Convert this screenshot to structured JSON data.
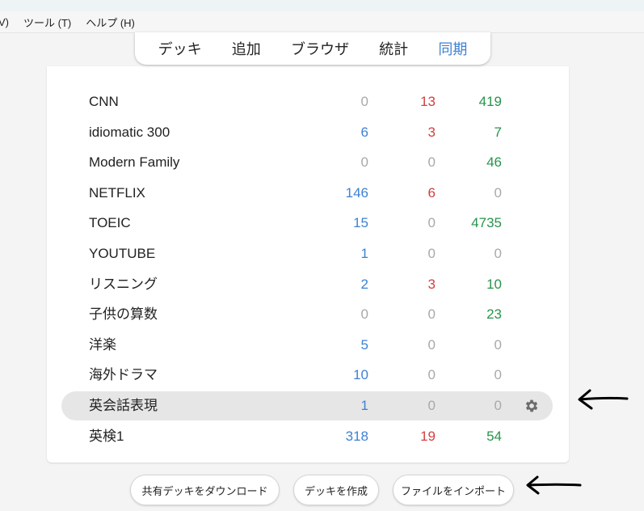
{
  "menu": {
    "items": [
      "V)",
      "ツール (T)",
      "ヘルプ (H)"
    ]
  },
  "toolbar": {
    "tabs": [
      {
        "label": "デッキ",
        "active": false
      },
      {
        "label": "追加",
        "active": false
      },
      {
        "label": "ブラウザ",
        "active": false
      },
      {
        "label": "統計",
        "active": false
      },
      {
        "label": "同期",
        "active": true
      }
    ]
  },
  "colors": {
    "new": "#3d82d4",
    "learn": "#d23f3f",
    "due": "#27944c",
    "zero": "#a9a9a9",
    "active_tab": "#3d82d4"
  },
  "decks": [
    {
      "name": "CNN",
      "new": "0",
      "learn": "13",
      "due": "419"
    },
    {
      "name": "idiomatic 300",
      "new": "6",
      "learn": "3",
      "due": "7"
    },
    {
      "name": "Modern Family",
      "new": "0",
      "learn": "0",
      "due": "46"
    },
    {
      "name": "NETFLIX",
      "new": "146",
      "learn": "6",
      "due": "0"
    },
    {
      "name": "TOEIC",
      "new": "15",
      "learn": "0",
      "due": "4735"
    },
    {
      "name": "YOUTUBE",
      "new": "1",
      "learn": "0",
      "due": "0"
    },
    {
      "name": "リスニング",
      "new": "2",
      "learn": "3",
      "due": "10"
    },
    {
      "name": "子供の算数",
      "new": "0",
      "learn": "0",
      "due": "23"
    },
    {
      "name": "洋楽",
      "new": "5",
      "learn": "0",
      "due": "0"
    },
    {
      "name": "海外ドラマ",
      "new": "10",
      "learn": "0",
      "due": "0"
    },
    {
      "name": "英会話表現",
      "new": "1",
      "learn": "0",
      "due": "0",
      "selected": true,
      "icon": "gear-icon"
    },
    {
      "name": "英検1",
      "new": "318",
      "learn": "19",
      "due": "54"
    }
  ],
  "buttons": {
    "shared_download": "共有デッキをダウンロード",
    "create_deck": "デッキを作成",
    "import_file": "ファイルをインポート"
  },
  "annotations": {
    "arrow_icon": "hand-drawn-left-arrow"
  }
}
